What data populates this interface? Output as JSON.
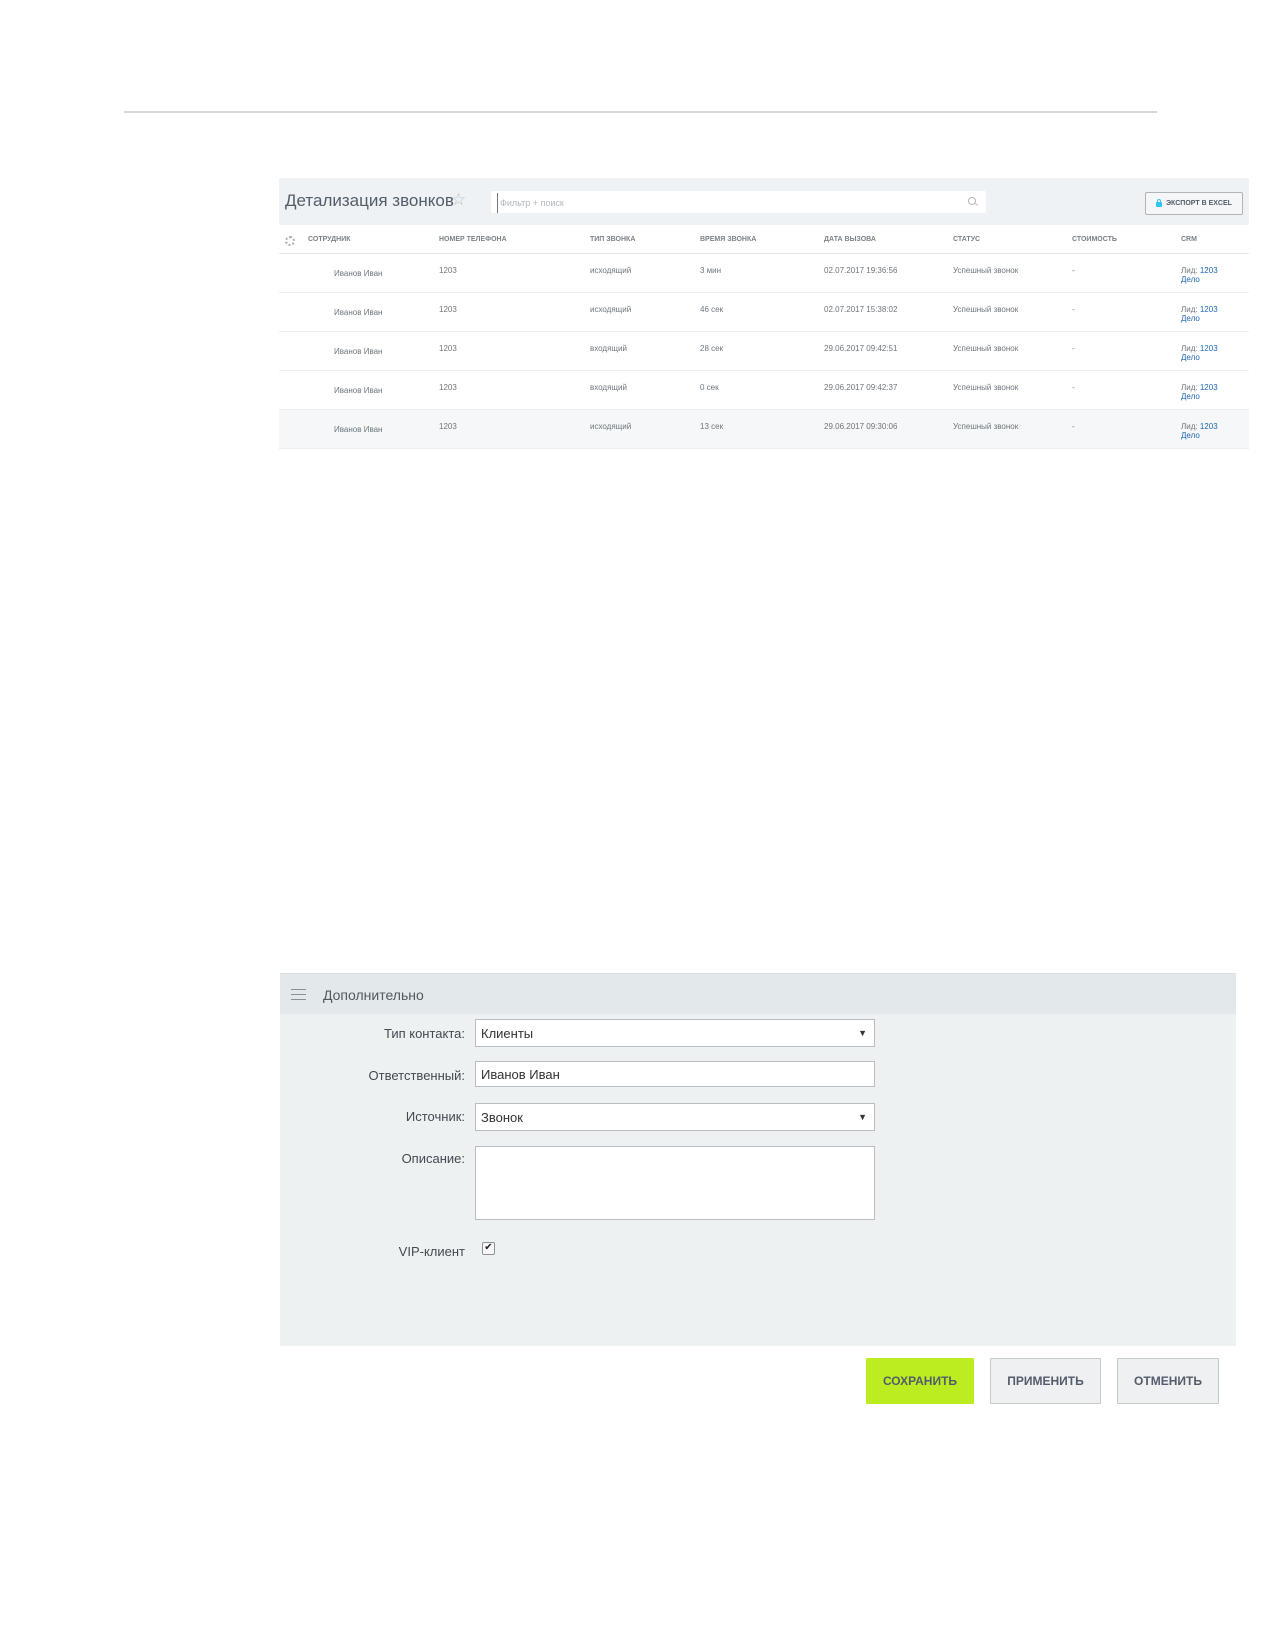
{
  "calls": {
    "title": "Детализация звонков",
    "search_placeholder": "Фильтр + поиск",
    "export_label": "ЭКСПОРТ В EXCEL",
    "columns": [
      "СОТРУДНИК",
      "НОМЕР ТЕЛЕФОНА",
      "ТИП ЗВОНКА",
      "ВРЕМЯ ЗВОНКА",
      "ДАТА ВЫЗОВА",
      "СТАТУС",
      "СТОИМОСТЬ",
      "CRM"
    ],
    "rows": [
      {
        "employee": "Иванов Иван",
        "phone": "1203",
        "type": "исходящий",
        "duration": "3 мин",
        "date": "02.07.2017 19:36:56",
        "status": "Успешный звонок",
        "cost": "-",
        "crm_lead_label": "Лид:",
        "crm_lead_link": "1203",
        "crm_deal": "Дело"
      },
      {
        "employee": "Иванов Иван",
        "phone": "1203",
        "type": "исходящий",
        "duration": "46 сек",
        "date": "02.07.2017 15:38:02",
        "status": "Успешный звонок",
        "cost": "-",
        "crm_lead_label": "Лид:",
        "crm_lead_link": "1203",
        "crm_deal": "Дело"
      },
      {
        "employee": "Иванов Иван",
        "phone": "1203",
        "type": "входящий",
        "duration": "28 сек",
        "date": "29.06.2017 09:42:51",
        "status": "Успешный звонок",
        "cost": "-",
        "crm_lead_label": "Лид:",
        "crm_lead_link": "1203",
        "crm_deal": "Дело"
      },
      {
        "employee": "Иванов Иван",
        "phone": "1203",
        "type": "входящий",
        "duration": "0 сек",
        "date": "29.06.2017 09:42:37",
        "status": "Успешный звонок",
        "cost": "-",
        "crm_lead_label": "Лид:",
        "crm_lead_link": "1203",
        "crm_deal": "Дело"
      },
      {
        "employee": "Иванов Иван",
        "phone": "1203",
        "type": "исходящий",
        "duration": "13 сек",
        "date": "29.06.2017 09:30:06",
        "status": "Успешный звонок",
        "cost": "-",
        "crm_lead_label": "Лид:",
        "crm_lead_link": "1203",
        "crm_deal": "Дело"
      }
    ]
  },
  "extra": {
    "title": "Дополнительно",
    "contact_type_label": "Тип контакта:",
    "contact_type_value": "Клиенты",
    "responsible_label": "Ответственный:",
    "responsible_value": "Иванов Иван",
    "source_label": "Источник:",
    "source_value": "Звонок",
    "description_label": "Описание:",
    "description_value": "",
    "vip_label": "VIP-клиент",
    "vip_checked": true
  },
  "buttons": {
    "save": "СОХРАНИТЬ",
    "apply": "ПРИМЕНИТЬ",
    "cancel": "ОТМЕНИТЬ"
  },
  "colors": {
    "accent_save": "#bbed21",
    "link": "#2067b0",
    "panel_bg": "#eef1f2"
  }
}
